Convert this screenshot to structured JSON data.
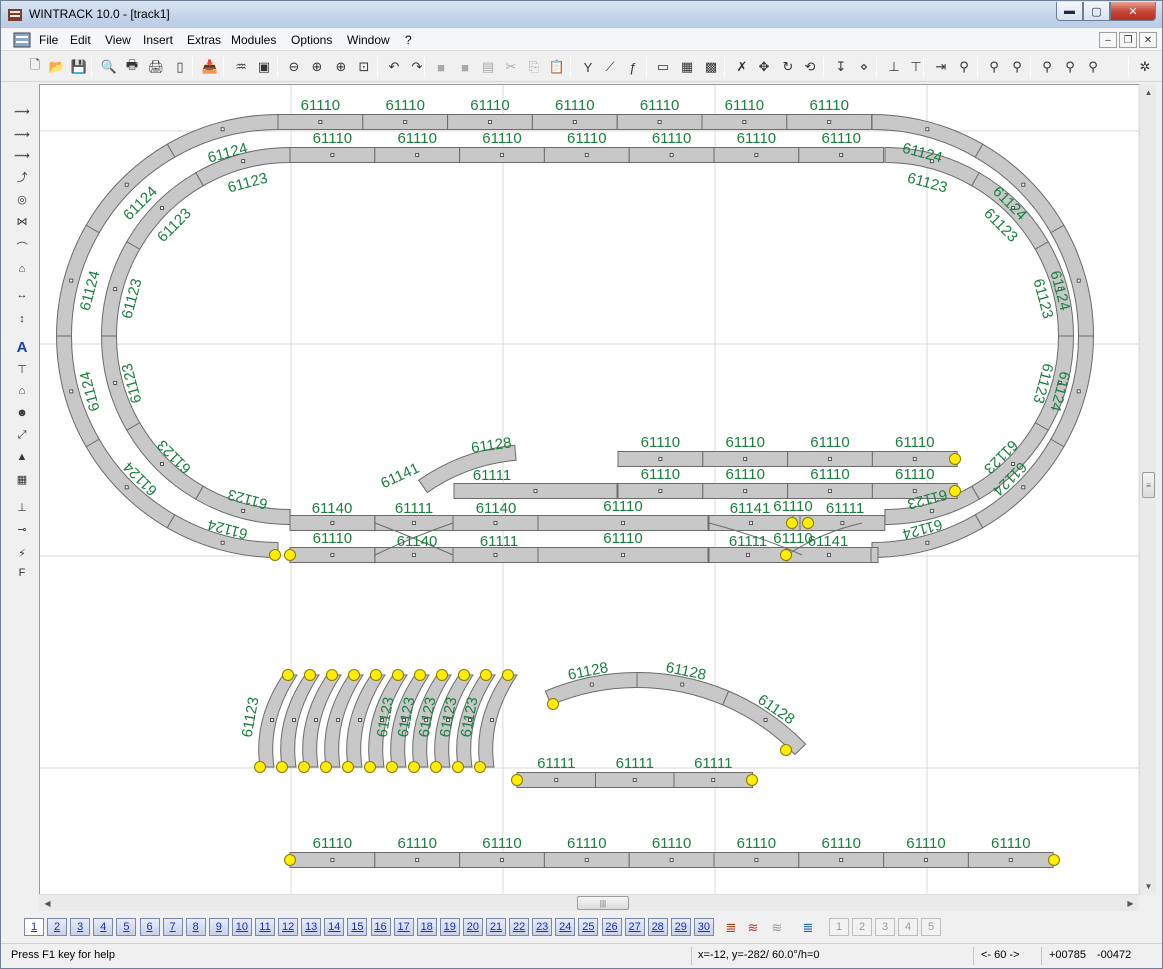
{
  "window": {
    "title": "WINTRACK 10.0 - [track1]",
    "caption_buttons": {
      "minimize": "▬",
      "maximize": "▢",
      "close": "✕"
    }
  },
  "menu": {
    "items": [
      "File",
      "Edit",
      "View",
      "Insert",
      "Extras",
      "Modules",
      "Options",
      "Window",
      "?"
    ],
    "mdi_buttons": [
      "–",
      "❐",
      "✕"
    ]
  },
  "toolbar": {
    "icons": [
      "new-file-icon",
      "open-folder-icon",
      "save-icon",
      "print-preview-icon",
      "print-icon",
      "print-setup-icon",
      "page-icon",
      "export-icon",
      "track-list-icon",
      "landscape-icon",
      "zoom-out-icon",
      "zoom-in-icon",
      "zoom-area-icon",
      "zoom-fit-icon",
      "undo-icon",
      "redo-icon",
      "module-a-icon",
      "module-b-icon",
      "module-c-icon",
      "cut-icon",
      "copy-icon",
      "paste-icon",
      "turnout-icon",
      "curve-select-icon",
      "flex-icon",
      "layer-a-icon",
      "layer-b-icon",
      "layer-c-icon",
      "delete-track-icon",
      "move-icon",
      "rotate-icon",
      "rotate-180-icon",
      "insert-icon",
      "connect-icon",
      "split-icon",
      "join-icon",
      "align-icon",
      "measure-a-icon",
      "measure-b-icon",
      "measure-c-icon",
      "measure-d-icon",
      "measure-e-icon",
      "measure-f-icon",
      "settings-icon"
    ]
  },
  "tools": {
    "icons": [
      "flex-track-icon",
      "flex-track-curve-icon",
      "flex-track-angle-icon",
      "transition-icon",
      "turntable-icon",
      "crossing-icon",
      "bridge-icon",
      "tunnel-icon",
      "length-icon",
      "height-icon",
      "text-icon",
      "signal-icon",
      "building-icon",
      "figure-icon",
      "ramp-icon",
      "landscape-icon",
      "terrain-icon",
      "track-height-icon",
      "grade-icon",
      "wiring-icon",
      "frame-icon"
    ],
    "text_tool_label": "A"
  },
  "layout": {
    "curve_labels": [
      "61124",
      "61123",
      "61128",
      "61141",
      "61140",
      "61111"
    ],
    "straight_label": "61110"
  },
  "pages": {
    "labels": [
      "1",
      "2",
      "3",
      "4",
      "5",
      "6",
      "7",
      "8",
      "9",
      "10",
      "11",
      "12",
      "13",
      "14",
      "15",
      "16",
      "17",
      "18",
      "19",
      "20",
      "21",
      "22",
      "23",
      "24",
      "25",
      "26",
      "27",
      "28",
      "29",
      "30"
    ],
    "active": "1",
    "layer_icons": [
      "layer-stack-icon",
      "layer-red-icon",
      "layer-grey-icon",
      "layer-blue-icon"
    ],
    "extra_pages": [
      "1",
      "2",
      "3",
      "4",
      "5"
    ]
  },
  "status": {
    "help": "Press F1 key for help",
    "coords": "x=-12, y=-282/ 60.0°/h=0",
    "nav": "<- 60 ->",
    "pos_x": "+00785",
    "pos_y": "-00472"
  },
  "colors": {
    "track_fill": "#c8c8c8",
    "track_stroke": "#6b6b6b",
    "label": "#1a7f3e",
    "endpoint": "#ffee00",
    "grid": "#d8d8d8"
  }
}
